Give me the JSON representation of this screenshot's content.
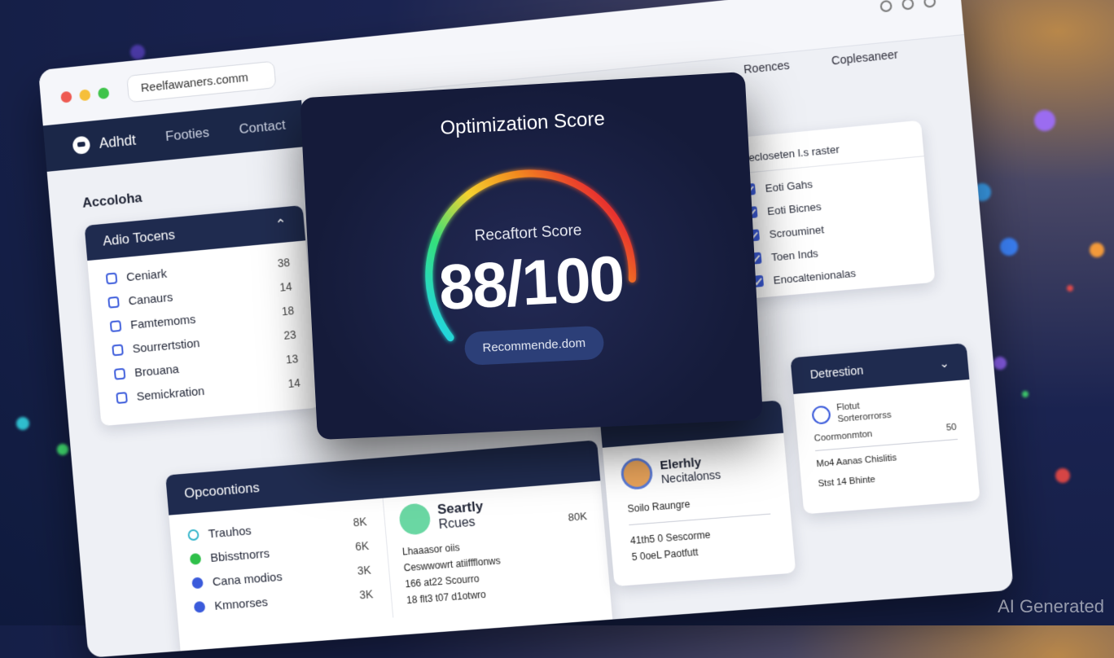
{
  "browser": {
    "url": "Reelfawaners.comm",
    "top_links": [
      "Roences",
      "Coplesaneer"
    ],
    "colors": {
      "close": "#ee5a52",
      "minimize": "#f6bf3a",
      "maximize": "#3fc34a"
    }
  },
  "navbar": {
    "brand": "Adhdt",
    "links": [
      "Footies",
      "Contact"
    ]
  },
  "sidebar": {
    "heading": "Accoloha",
    "card_title": "Adio Tocens",
    "items": [
      {
        "label": "Ceniark",
        "value": "38"
      },
      {
        "label": "Canaurs",
        "value": "14"
      },
      {
        "label": "Famtemoms",
        "value": "18"
      },
      {
        "label": "Sourrertstion",
        "value": "23"
      },
      {
        "label": "Brouana",
        "value": "13"
      },
      {
        "label": "Semickration",
        "value": "14"
      }
    ]
  },
  "modal": {
    "title": "Optimization Score",
    "subtitle": "Recaftort Score",
    "score_text": "88/100",
    "score": 88,
    "score_max": 100,
    "button": "Recommende.dom",
    "gauge_colors": [
      "#20d3f2",
      "#34e07a",
      "#f5d22f",
      "#f28a1f",
      "#e8322f"
    ]
  },
  "checklist": {
    "title": "Cecloseten l.s raster",
    "items": [
      "Eoti Gahs",
      "Eoti Bicnes",
      "Scrouminet",
      "Toen Inds",
      "Enocaltenionalas"
    ]
  },
  "opportunities": {
    "title": "Opcoontions",
    "items": [
      {
        "label": "Trauhos",
        "value": "8K"
      },
      {
        "label": "Bbisstnorrs",
        "value": "6K"
      },
      {
        "label": "Cana modios",
        "value": "3K"
      },
      {
        "label": "Kmnorses",
        "value": "3K"
      }
    ]
  },
  "search_card": {
    "title": "Seartly",
    "subtitle": "Rcues",
    "value": "80K",
    "lines": [
      "Lhaaasor oiis",
      "Ceswwowrt atiiffflonws",
      "166 at22 Scourro",
      "18 flt3 t07 d1otwro"
    ]
  },
  "profile_card": {
    "name": "Elerhly",
    "role": "Necitalonss",
    "tag": "Soilo Raungre",
    "lines": [
      "41th5 0 Sescorme",
      "5 0oeL Paotfutt"
    ]
  },
  "detection_card": {
    "title": "Detrestion",
    "icon_label_1": "Flotut",
    "icon_label_2": "Sorterorrorss",
    "row_label": "Coormonmton",
    "row_value": "50",
    "lines": [
      "Mo4 Aanas Chislitis",
      "Stst 14 Bhinte"
    ]
  },
  "watermark": "AI Generated"
}
